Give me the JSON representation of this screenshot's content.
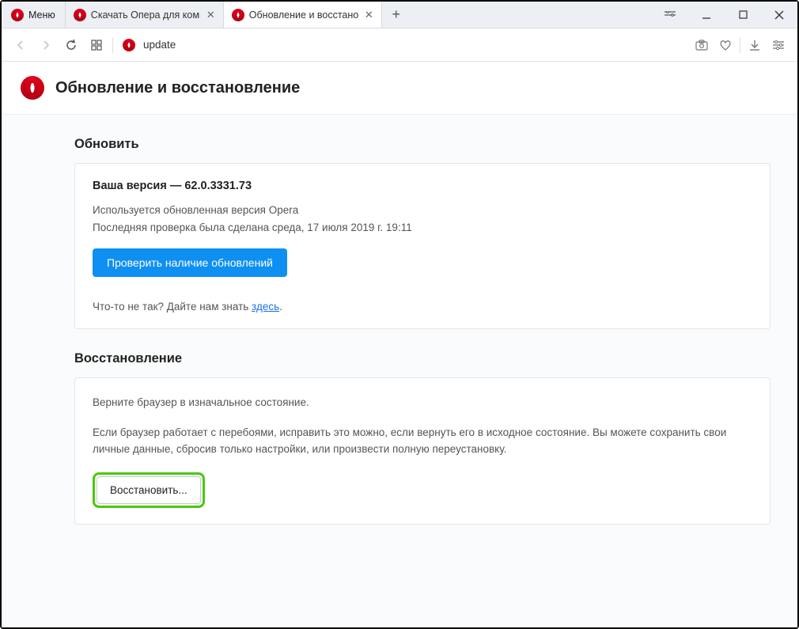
{
  "menu_label": "Меню",
  "tabs": [
    {
      "title": "Скачать Опера для компь"
    },
    {
      "title": "Обновление и восстановл"
    }
  ],
  "url_text": "update",
  "page_title": "Обновление и восстановление",
  "sections": {
    "update": {
      "heading": "Обновить",
      "version_prefix": "Ваша версия — ",
      "version_value": "62.0.3331.73",
      "status_line": "Используется обновленная версия Opera",
      "last_check_line": "Последняя проверка была сделана среда, 17 июля 2019 г. 19:11",
      "check_button": "Проверить наличие обновлений",
      "footnote_prefix": "Что-то не так? Дайте нам знать ",
      "footnote_link": "здесь",
      "footnote_suffix": "."
    },
    "recovery": {
      "heading": "Восстановление",
      "intro": "Верните браузер в изначальное состояние.",
      "desc": "Если браузер работает с перебоями, исправить это можно, если вернуть его в исходное состояние. Вы можете сохранить свои личные данные, сбросив только настройки, или произвести полную переустановку.",
      "restore_button": "Восстановить..."
    }
  }
}
